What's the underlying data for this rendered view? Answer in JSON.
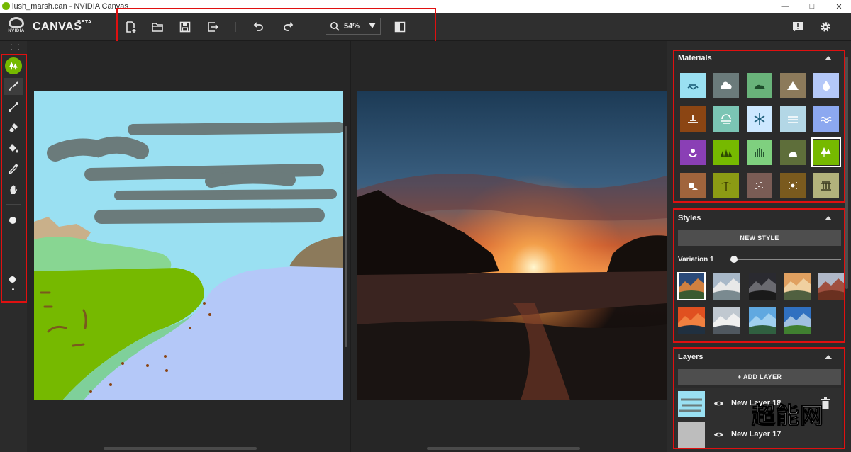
{
  "window": {
    "title": "lush_marsh.can - NVIDIA Canvas",
    "controls": [
      "minimize",
      "maximize",
      "close"
    ]
  },
  "brand": {
    "logo_text": "NVIDIA",
    "name": "CANVAS",
    "badge": "BETA"
  },
  "toolbar": {
    "buttons": [
      {
        "icon": "new-file-icon"
      },
      {
        "icon": "open-folder-icon"
      },
      {
        "icon": "save-icon"
      },
      {
        "icon": "export-icon"
      },
      {
        "icon": "undo-icon"
      },
      {
        "icon": "redo-icon"
      },
      {
        "icon": "compare-view-icon"
      }
    ],
    "zoom": {
      "value": "54%",
      "icon": "search-icon"
    },
    "right": [
      {
        "icon": "feedback-icon"
      },
      {
        "icon": "gear-icon"
      }
    ]
  },
  "tools": {
    "current_material_icon": "tree-material-icon",
    "items": [
      {
        "icon": "brush-icon",
        "active": true
      },
      {
        "icon": "line-icon"
      },
      {
        "icon": "eraser-icon"
      },
      {
        "icon": "fill-bucket-icon"
      },
      {
        "icon": "eyedropper-icon"
      },
      {
        "icon": "hand-pan-icon"
      }
    ],
    "brush_size_level": 1.0,
    "brush_opacity_level": 0.0
  },
  "panels": {
    "materials": {
      "title": "Materials",
      "items": [
        {
          "icon": "sea-icon",
          "color": "#9ae0f2"
        },
        {
          "icon": "cloud-icon",
          "color": "#6b7b7b"
        },
        {
          "icon": "hill-icon",
          "color": "#69b37a"
        },
        {
          "icon": "mountain-icon",
          "color": "#8c7a5b"
        },
        {
          "icon": "water-drop-icon",
          "color": "#b4c8f8"
        },
        {
          "icon": "dirt-icon",
          "color": "#8b4513"
        },
        {
          "icon": "fog-icon",
          "color": "#7bc5b4"
        },
        {
          "icon": "snow-icon",
          "color": "#cde8ff"
        },
        {
          "icon": "river-icon",
          "color": "#b3d7e6"
        },
        {
          "icon": "lake-icon",
          "color": "#8ca8f0"
        },
        {
          "icon": "flower-icon",
          "color": "#8a3fb5"
        },
        {
          "icon": "grass-icon",
          "color": "#76b900"
        },
        {
          "icon": "bush-icon",
          "color": "#7fd07f"
        },
        {
          "icon": "rock-icon",
          "color": "#5e6e3a"
        },
        {
          "icon": "tree-icon",
          "color": "#76b900",
          "selected": true
        },
        {
          "icon": "stone-icon",
          "color": "#a0643c"
        },
        {
          "icon": "palm-icon",
          "color": "#8c9b14"
        },
        {
          "icon": "sand-icon",
          "color": "#7a5c55"
        },
        {
          "icon": "gravel-icon",
          "color": "#7a5a1e"
        },
        {
          "icon": "building-icon",
          "color": "#b2b27c"
        }
      ]
    },
    "styles": {
      "title": "Styles",
      "new_style_label": "NEW STYLE",
      "variation_label": "Variation 1",
      "variation_level": 0.0,
      "thumbs": [
        {
          "icon": "style-mountain-lake-thumb",
          "selected": true
        },
        {
          "icon": "style-snowy-peaks-thumb"
        },
        {
          "icon": "style-cave-arch-thumb"
        },
        {
          "icon": "style-misty-valley-thumb"
        },
        {
          "icon": "style-red-cliffs-thumb"
        },
        {
          "icon": "style-sunset-sea-thumb"
        },
        {
          "icon": "style-winter-mountains-thumb"
        },
        {
          "icon": "style-tropical-coast-thumb"
        },
        {
          "icon": "style-alpine-lake-thumb"
        }
      ]
    },
    "layers": {
      "title": "Layers",
      "add_label": "+ ADD LAYER",
      "items": [
        {
          "name": "New Layer 18"
        },
        {
          "name": "New Layer 17"
        }
      ]
    }
  },
  "watermark": "超能网"
}
